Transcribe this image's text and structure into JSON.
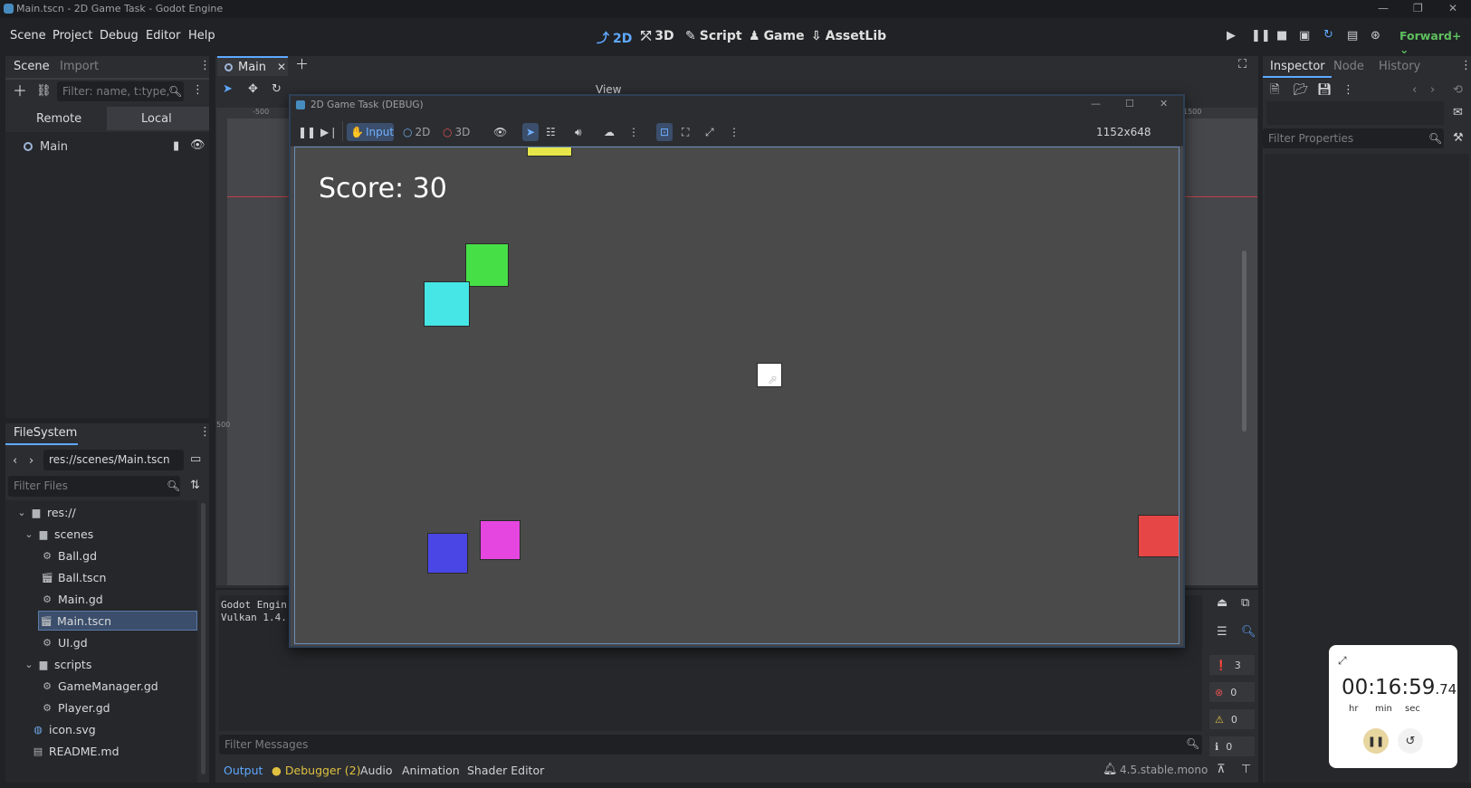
{
  "window": {
    "title": "Main.tscn - 2D Game Task - Godot Engine"
  },
  "menu": [
    "Scene",
    "Project",
    "Debug",
    "Editor",
    "Help"
  ],
  "workspaces": [
    {
      "label": "2D",
      "icon": "2d-icon",
      "active": true
    },
    {
      "label": "3D",
      "icon": "3d-icon",
      "active": false
    },
    {
      "label": "Script",
      "icon": "script-icon",
      "active": false
    },
    {
      "label": "Game",
      "icon": "game-icon",
      "active": false
    },
    {
      "label": "AssetLib",
      "icon": "assetlib-icon",
      "active": false
    }
  ],
  "renderer": "Forward+",
  "scene_dock": {
    "tabs": [
      "Scene",
      "Import"
    ],
    "filter_placeholder": "Filter: name, t:type,",
    "modes": [
      "Remote",
      "Local"
    ],
    "root_node": "Main"
  },
  "filesystem": {
    "title": "FileSystem",
    "path": "res://scenes/Main.tscn",
    "filter_placeholder": "Filter Files",
    "items": [
      {
        "label": "res://",
        "type": "folder",
        "depth": 0
      },
      {
        "label": "scenes",
        "type": "folder",
        "depth": 1
      },
      {
        "label": "Ball.gd",
        "type": "script",
        "depth": 2
      },
      {
        "label": "Ball.tscn",
        "type": "scene",
        "depth": 2
      },
      {
        "label": "Main.gd",
        "type": "script",
        "depth": 2
      },
      {
        "label": "Main.tscn",
        "type": "scene",
        "depth": 2,
        "selected": true
      },
      {
        "label": "UI.gd",
        "type": "script",
        "depth": 2
      },
      {
        "label": "scripts",
        "type": "folder",
        "depth": 1
      },
      {
        "label": "GameManager.gd",
        "type": "script",
        "depth": 2
      },
      {
        "label": "Player.gd",
        "type": "script",
        "depth": 2
      },
      {
        "label": "icon.svg",
        "type": "image",
        "depth": 1
      },
      {
        "label": "README.md",
        "type": "doc",
        "depth": 1
      }
    ]
  },
  "editor": {
    "tab": "Main",
    "view_menu": "View",
    "zoom_prefix": "6",
    "ruler_labels": [
      "-500",
      "1500",
      "500"
    ]
  },
  "inspector": {
    "tabs": [
      "Inspector",
      "Node",
      "History"
    ],
    "filter_placeholder": "Filter Properties"
  },
  "bottom": {
    "output_lines": [
      "Godot Engin",
      "Vulkan 1.4."
    ],
    "filter_placeholder": "Filter Messages",
    "tabs": [
      "Output",
      "Debugger (2)",
      "Audio",
      "Animation",
      "Shader Editor"
    ],
    "counters": [
      {
        "icon": "warning-count-icon",
        "value": "3"
      },
      {
        "icon": "error-icon",
        "value": "0"
      },
      {
        "icon": "caution-icon",
        "value": "0"
      },
      {
        "icon": "info-icon",
        "value": "0"
      }
    ],
    "version": "4.5.stable.mono"
  },
  "game_window": {
    "title": "2D Game Task (DEBUG)",
    "toolbar": {
      "input": "Input",
      "two_d": "2D",
      "three_d": "3D",
      "resolution": "1152x648"
    },
    "score_text": "Score: 30",
    "colors": {
      "yellow": "#e6e64a",
      "green": "#46e046",
      "cyan": "#46e6e6",
      "white": "#ffffff",
      "blue": "#4a46e6",
      "magenta": "#e646e0",
      "red": "#e64646"
    }
  },
  "timer": {
    "hours": "00",
    "minutes": "16",
    "seconds": "59",
    "fraction": ".74",
    "labels": [
      "hr",
      "min",
      "sec"
    ]
  }
}
